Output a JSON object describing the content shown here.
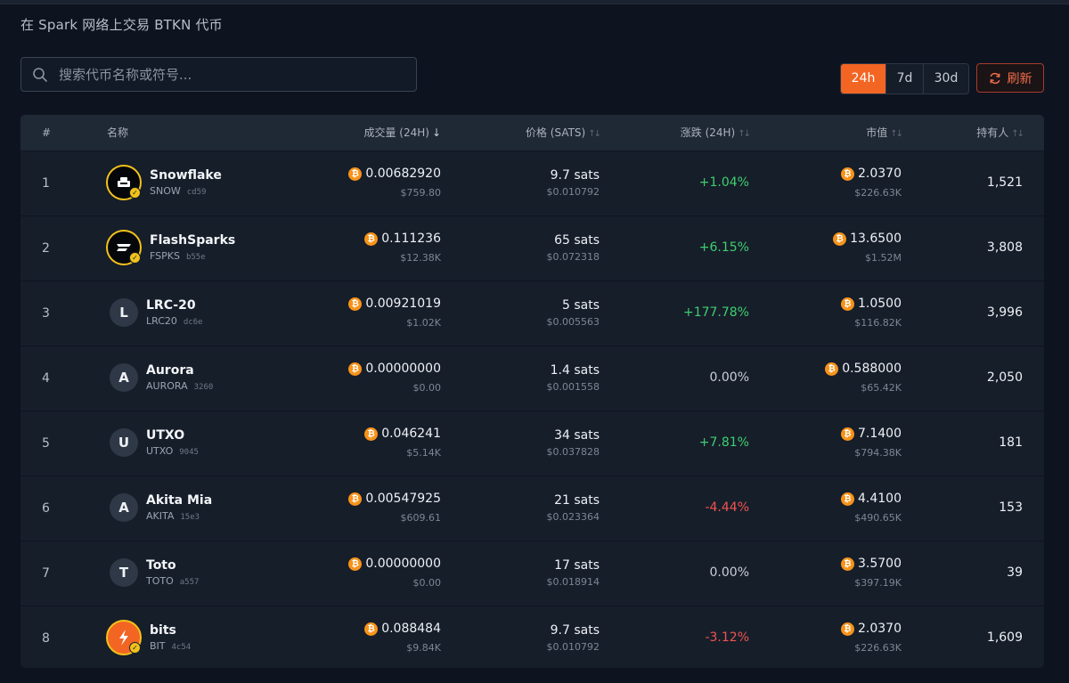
{
  "page": {
    "subtitle": "在 Spark 网络上交易 BTKN 代币"
  },
  "search": {
    "placeholder": "搜索代币名称或符号..."
  },
  "range": {
    "options": [
      "24h",
      "7d",
      "30d"
    ],
    "selected": "24h"
  },
  "refresh_label": "刷新",
  "colors": {
    "accent": "#f26522",
    "positive": "#3ecf6e",
    "negative": "#f0544f",
    "neutral": "#c8cfd8",
    "btc": "#f7931a"
  },
  "table": {
    "headers": {
      "rank": "#",
      "name": "名称",
      "volume": "成交量 (24H)",
      "price": "价格 (SATS)",
      "change": "涨跌 (24H)",
      "mcap": "市值",
      "holders": "持有人"
    },
    "sort_column": "volume",
    "rows": [
      {
        "rank": "1",
        "name": "Snowflake",
        "symbol": "SNOW",
        "hash": "cd59",
        "avatar": "logo",
        "avatar_icon": "snowflake-logo-icon",
        "volume_btc": "0.00682920",
        "volume_usd": "$759.80",
        "price_sats": "9.7 sats",
        "price_usd": "$0.010792",
        "change": "+1.04%",
        "trend": "up",
        "mcap_btc": "2.0370",
        "mcap_usd": "$226.63K",
        "holders": "1,521"
      },
      {
        "rank": "2",
        "name": "FlashSparks",
        "symbol": "FSPKS",
        "hash": "b55e",
        "avatar": "logo",
        "avatar_icon": "flashsparks-logo-icon",
        "volume_btc": "0.111236",
        "volume_usd": "$12.38K",
        "price_sats": "65 sats",
        "price_usd": "$0.072318",
        "change": "+6.15%",
        "trend": "up",
        "mcap_btc": "13.6500",
        "mcap_usd": "$1.52M",
        "holders": "3,808"
      },
      {
        "rank": "3",
        "name": "LRC-20",
        "symbol": "LRC20",
        "hash": "dc6e",
        "avatar": "L",
        "volume_btc": "0.00921019",
        "volume_usd": "$1.02K",
        "price_sats": "5 sats",
        "price_usd": "$0.005563",
        "change": "+177.78%",
        "trend": "up",
        "mcap_btc": "1.0500",
        "mcap_usd": "$116.82K",
        "holders": "3,996"
      },
      {
        "rank": "4",
        "name": "Aurora",
        "symbol": "AURORA",
        "hash": "3260",
        "avatar": "A",
        "volume_btc": "0.00000000",
        "volume_usd": "$0.00",
        "price_sats": "1.4 sats",
        "price_usd": "$0.001558",
        "change": "0.00%",
        "trend": "flat",
        "mcap_btc": "0.588000",
        "mcap_usd": "$65.42K",
        "holders": "2,050"
      },
      {
        "rank": "5",
        "name": "UTXO",
        "symbol": "UTXO",
        "hash": "9045",
        "avatar": "U",
        "volume_btc": "0.046241",
        "volume_usd": "$5.14K",
        "price_sats": "34 sats",
        "price_usd": "$0.037828",
        "change": "+7.81%",
        "trend": "up",
        "mcap_btc": "7.1400",
        "mcap_usd": "$794.38K",
        "holders": "181"
      },
      {
        "rank": "6",
        "name": "Akita Mia",
        "symbol": "AKITA",
        "hash": "15e3",
        "avatar": "A",
        "volume_btc": "0.00547925",
        "volume_usd": "$609.61",
        "price_sats": "21 sats",
        "price_usd": "$0.023364",
        "change": "-4.44%",
        "trend": "down",
        "mcap_btc": "4.4100",
        "mcap_usd": "$490.65K",
        "holders": "153"
      },
      {
        "rank": "7",
        "name": "Toto",
        "symbol": "TOTO",
        "hash": "a557",
        "avatar": "T",
        "volume_btc": "0.00000000",
        "volume_usd": "$0.00",
        "price_sats": "17 sats",
        "price_usd": "$0.018914",
        "change": "0.00%",
        "trend": "flat",
        "mcap_btc": "3.5700",
        "mcap_usd": "$397.19K",
        "holders": "39"
      },
      {
        "rank": "8",
        "name": "bits",
        "symbol": "BIT",
        "hash": "4c54",
        "avatar": "logo",
        "avatar_icon": "bits-logo-icon",
        "volume_btc": "0.088484",
        "volume_usd": "$9.84K",
        "price_sats": "9.7 sats",
        "price_usd": "$0.010792",
        "change": "-3.12%",
        "trend": "down",
        "mcap_btc": "2.0370",
        "mcap_usd": "$226.63K",
        "holders": "1,609"
      }
    ]
  }
}
